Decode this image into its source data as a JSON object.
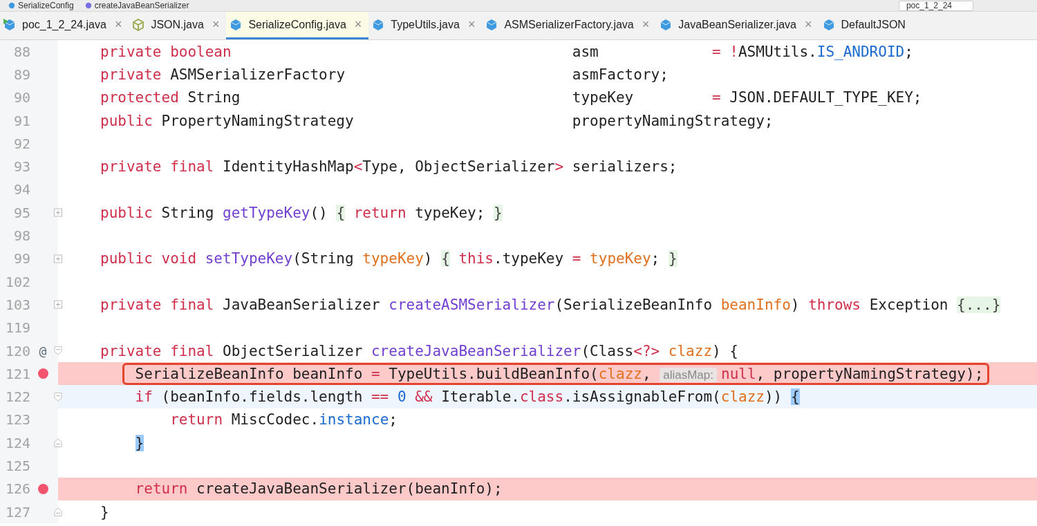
{
  "breadcrumbs": [
    {
      "label": "SerializeConfig",
      "kind": "class"
    },
    {
      "label": "createJavaBeanSerializer",
      "kind": "method"
    }
  ],
  "run_config": "poc_1_2_24",
  "tabs": [
    {
      "label": "poc_1_2_24.java",
      "selected": false,
      "kind": "runnable",
      "close": "×"
    },
    {
      "label": "JSON.java",
      "selected": false,
      "kind": "outline",
      "close": "×"
    },
    {
      "label": "SerializeConfig.java",
      "selected": true,
      "kind": "class",
      "close": "×"
    },
    {
      "label": "TypeUtils.java",
      "selected": false,
      "kind": "class",
      "close": "×"
    },
    {
      "label": "ASMSerializerFactory.java",
      "selected": false,
      "kind": "class",
      "close": "×"
    },
    {
      "label": "JavaBeanSerializer.java",
      "selected": false,
      "kind": "class",
      "close": "×"
    },
    {
      "label": "DefaultJSON",
      "selected": false,
      "kind": "class"
    }
  ],
  "lines": [
    {
      "number": "88",
      "breakpoint": false,
      "current": false,
      "tokens": [
        {
          "kind": "kw",
          "text": "private boolean"
        },
        {
          "kind": "plain",
          "text": "                                       asm             "
        },
        {
          "kind": "kw",
          "text": "= !"
        },
        {
          "kind": "plain",
          "text": "ASMUtils."
        },
        {
          "kind": "field",
          "text": "IS_ANDROID"
        },
        {
          "kind": "plain",
          "text": ";"
        }
      ]
    },
    {
      "number": "89",
      "breakpoint": false,
      "current": false,
      "tokens": [
        {
          "kind": "kw",
          "text": "private"
        },
        {
          "kind": "plain",
          "text": " ASMSerializerFactory                          asmFactory;"
        }
      ]
    },
    {
      "number": "90",
      "breakpoint": false,
      "current": false,
      "tokens": [
        {
          "kind": "kw",
          "text": "protected"
        },
        {
          "kind": "plain",
          "text": " String                                      typeKey         "
        },
        {
          "kind": "kw",
          "text": "="
        },
        {
          "kind": "plain",
          "text": " JSON.DEFAULT_TYPE_KEY;"
        }
      ]
    },
    {
      "number": "91",
      "breakpoint": false,
      "current": false,
      "tokens": [
        {
          "kind": "kw",
          "text": "public"
        },
        {
          "kind": "plain",
          "text": " PropertyNamingStrategy                         propertyNamingStrategy;"
        }
      ]
    },
    {
      "number": "92",
      "breakpoint": false,
      "current": false
    },
    {
      "number": "93",
      "breakpoint": false,
      "current": false,
      "tokens": [
        {
          "kind": "kw",
          "text": "private final"
        },
        {
          "kind": "plain",
          "text": " IdentityHashMap"
        },
        {
          "kind": "kw",
          "text": "<"
        },
        {
          "kind": "plain",
          "text": "Type, ObjectSerializer"
        },
        {
          "kind": "kw",
          "text": ">"
        },
        {
          "kind": "plain",
          "text": " serializers;"
        }
      ]
    },
    {
      "number": "94",
      "breakpoint": false,
      "current": false
    },
    {
      "number": "95",
      "kind": "collapsed",
      "breakpoint": false,
      "current": false,
      "tokens": [
        {
          "kind": "kw",
          "text": "public"
        },
        {
          "kind": "plain",
          "text": " String "
        },
        {
          "kind": "fn",
          "text": "getTypeKey"
        },
        {
          "kind": "plain",
          "text": "() "
        },
        {
          "kind": "fold",
          "text": "{"
        },
        {
          "kind": "kw",
          "text": " return"
        },
        {
          "kind": "plain",
          "text": " typeKey; "
        },
        {
          "kind": "fold",
          "text": "}"
        }
      ]
    },
    {
      "number": "98",
      "breakpoint": false,
      "current": false
    },
    {
      "number": "99",
      "kind": "collapsed",
      "breakpoint": false,
      "current": false,
      "tokens": [
        {
          "kind": "kw",
          "text": "public void "
        },
        {
          "kind": "fn",
          "text": "setTypeKey"
        },
        {
          "kind": "plain",
          "text": "(String "
        },
        {
          "kind": "param",
          "text": "typeKey"
        },
        {
          "kind": "plain",
          "text": ") "
        },
        {
          "kind": "fold",
          "text": "{"
        },
        {
          "kind": "kw",
          "text": " this"
        },
        {
          "kind": "plain",
          "text": ".typeKey "
        },
        {
          "kind": "kw",
          "text": "= "
        },
        {
          "kind": "param",
          "text": "typeKey"
        },
        {
          "kind": "plain",
          "text": "; "
        },
        {
          "kind": "fold",
          "text": "}"
        }
      ]
    },
    {
      "number": "102",
      "breakpoint": false,
      "current": false
    },
    {
      "number": "103",
      "kind": "collapsed",
      "breakpoint": false,
      "current": false,
      "tokens": [
        {
          "kind": "kw",
          "text": "private final"
        },
        {
          "kind": "plain",
          "text": " JavaBeanSerializer "
        },
        {
          "kind": "fn",
          "text": "createASMSerializer"
        },
        {
          "kind": "plain",
          "text": "(SerializeBeanInfo "
        },
        {
          "kind": "param",
          "text": "beanInfo"
        },
        {
          "kind": "plain",
          "text": ") "
        },
        {
          "kind": "kw",
          "text": "throws"
        },
        {
          "kind": "plain",
          "text": " Exception "
        },
        {
          "kind": "fold",
          "text": "{...}"
        }
      ]
    },
    {
      "number": "119",
      "breakpoint": false,
      "current": false
    },
    {
      "number": "120",
      "kind": "opening",
      "mark": "@",
      "breakpoint": false,
      "current": false,
      "tokens": [
        {
          "kind": "kw",
          "text": "private final"
        },
        {
          "kind": "plain",
          "text": " ObjectSerializer "
        },
        {
          "kind": "fn",
          "text": "createJavaBeanSerializer"
        },
        {
          "kind": "plain",
          "text": "(Class"
        },
        {
          "kind": "kw",
          "text": "<?> "
        },
        {
          "kind": "param",
          "text": "clazz"
        },
        {
          "kind": "plain",
          "text": ") {"
        }
      ],
      "children": [
        {
          "number": "121",
          "breakpoint": true,
          "current": false,
          "boxed": true,
          "tokens": [
            {
              "kind": "plain",
              "text": "SerializeBeanInfo beanInfo "
            },
            {
              "kind": "kw",
              "text": "="
            },
            {
              "kind": "plain",
              "text": " TypeUtils.buildBeanInfo("
            },
            {
              "kind": "param",
              "text": "clazz"
            },
            {
              "kind": "plain",
              "text": ", "
            },
            {
              "kind": "hint",
              "text": "aliasMap:"
            },
            {
              "kind": "kw",
              "text": "null"
            },
            {
              "kind": "plain",
              "text": ", propertyNamingStrategy);"
            }
          ]
        },
        {
          "number": "122",
          "kind": "opening",
          "breakpoint": false,
          "current": true,
          "tokens": [
            {
              "kind": "kw",
              "text": "if"
            },
            {
              "kind": "plain",
              "text": " (beanInfo.fields.length "
            },
            {
              "kind": "kw",
              "text": "== "
            },
            {
              "kind": "num",
              "text": "0"
            },
            {
              "kind": "kw",
              "text": " &&"
            },
            {
              "kind": "plain",
              "text": " Iterable."
            },
            {
              "kind": "kw",
              "text": "class"
            },
            {
              "kind": "plain",
              "text": ".isAssignableFrom("
            },
            {
              "kind": "param",
              "text": "clazz"
            },
            {
              "kind": "plain",
              "text": ")) "
            },
            {
              "kind": "match",
              "text": "{"
            }
          ],
          "children": [
            {
              "number": "123",
              "breakpoint": false,
              "current": false,
              "tokens": [
                {
                  "kind": "kw",
                  "text": "return"
                },
                {
                  "kind": "plain",
                  "text": " MiscCodec."
                },
                {
                  "kind": "field",
                  "text": "instance"
                },
                {
                  "kind": "plain",
                  "text": ";"
                }
              ]
            }
          ]
        },
        {
          "number": "124",
          "kind": "closing",
          "breakpoint": false,
          "current": false,
          "tokens": [
            {
              "kind": "match",
              "text": "}"
            }
          ]
        },
        {
          "number": "125",
          "breakpoint": false,
          "current": false
        },
        {
          "number": "126",
          "breakpoint": true,
          "current": false,
          "tokens": [
            {
              "kind": "kw",
              "text": "return"
            },
            {
              "kind": "plain",
              "text": " createJavaBeanSerializer(beanInfo);"
            }
          ]
        }
      ]
    },
    {
      "number": "127",
      "kind": "closing",
      "breakpoint": false,
      "current": false,
      "tokens": [
        {
          "kind": "plain",
          "text": "}"
        }
      ]
    }
  ]
}
